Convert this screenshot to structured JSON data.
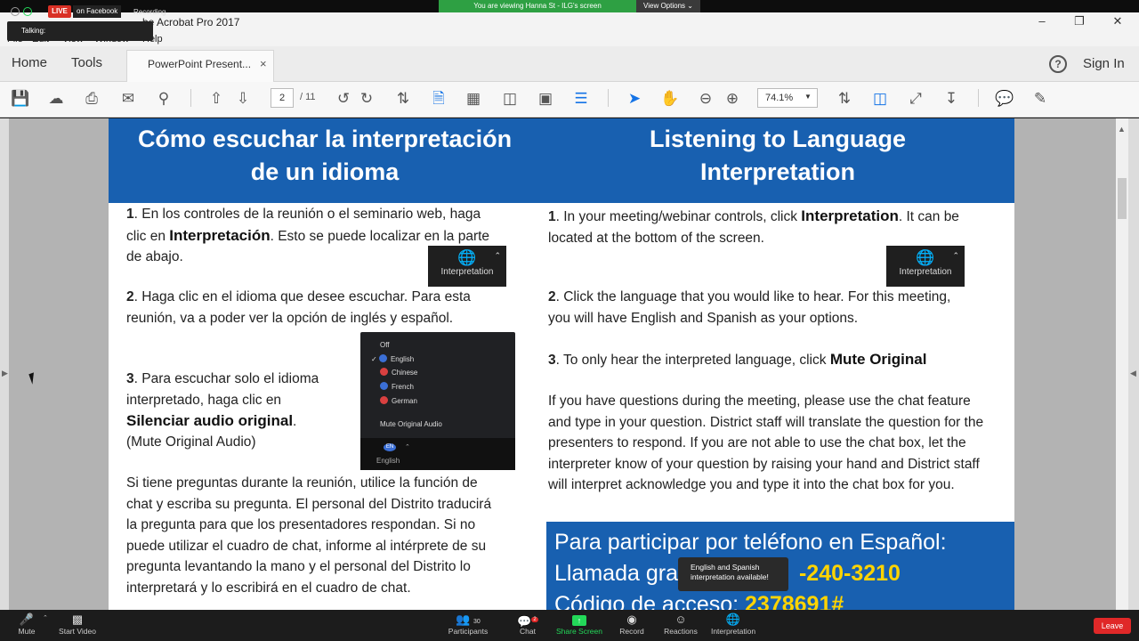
{
  "zoom": {
    "share_banner": "You are viewing Hanna St - ILG's screen",
    "view_options": "View Options ⌄",
    "live_badge": "LIVE",
    "live_target": "on Facebook",
    "recording_label": "Recording",
    "talking_label": "Talking:",
    "bottom_bar": [
      {
        "name": "mute",
        "label": "Mute",
        "icon": "microphone-icon"
      },
      {
        "name": "start-video",
        "label": "Start Video",
        "icon": "video-off-icon"
      },
      {
        "name": "participants",
        "label": "Participants",
        "icon": "participants-icon",
        "count": "30"
      },
      {
        "name": "chat",
        "label": "Chat",
        "icon": "chat-icon",
        "badge": "2"
      },
      {
        "name": "share-screen",
        "label": "Share Screen",
        "icon": "share-screen-icon"
      },
      {
        "name": "record",
        "label": "Record",
        "icon": "record-icon"
      },
      {
        "name": "reactions",
        "label": "Reactions",
        "icon": "reactions-icon"
      },
      {
        "name": "interpretation",
        "label": "Interpretation",
        "icon": "globe-icon"
      }
    ],
    "leave_label": "Leave",
    "toast": "English and Spanish interpretation available!"
  },
  "acrobat": {
    "window_title": "be Acrobat Pro 2017",
    "menu": [
      "File",
      "Edit",
      "View",
      "Window",
      "Help"
    ],
    "tabs": {
      "home": "Home",
      "tools": "Tools",
      "document": "PowerPoint Present...",
      "close": "×"
    },
    "help_glyph": "?",
    "sign_in": "Sign In",
    "page_current": "2",
    "page_total": "/ 11",
    "zoom_level": "74.1%"
  },
  "slide": {
    "es": {
      "title_line1": "Cómo escuchar la interpretación",
      "title_line2": "de un idioma",
      "step1_num": "1",
      "step1_pre": ". En los controles de la reunión o el seminario web, haga clic en ",
      "step1_kw": "Interpretación",
      "step1_post": ". Esto se puede localizar en la parte de abajo.",
      "step2_num": "2",
      "step2": ". Haga clic en el idioma que desee escuchar. Para esta reunión, va a poder ver la opción de inglés y español.",
      "step3_num": "3",
      "step3_pre": ". Para escuchar solo el idioma interpretado, haga clic en",
      "step3_kw": "Silenciar audio original",
      "step3_post": ".",
      "step3_note": "(Mute Original Audio)",
      "questions": "Si tiene preguntas durante la reunión, utilice la función de chat y escriba su pregunta. El personal del Distrito traducirá la pregunta para que los presentadores respondan. Si no puede utilizar el cuadro de chat, informe al intérprete de su pregunta levantando la mano y el personal del Distrito lo interpretará y lo escribirá en el cuadro de chat."
    },
    "en": {
      "title_line1": "Listening to Language",
      "title_line2": "Interpretation",
      "step1_num": "1",
      "step1_pre": ". In your meeting/webinar controls, click ",
      "step1_kw": "Interpretation",
      "step1_post": ". It can be located at the bottom of the screen.",
      "step2_num": "2",
      "step2": ". Click the language that you would like to hear. For this meeting, you will  have English and Spanish as your options.",
      "step3_num": "3",
      "step3_pre": ". To only hear the interpreted language, click ",
      "step3_kw": "Mute Original",
      "questions": "If you have questions during the meeting, please use the chat feature and type in your question. District staff will translate the question for the presenters to respond. If you are not able to use the chat box, let the interpreter  know  of your  question by raising  your hand and District staff will interpret acknowledge you  and type it  into  the chat box  for you.",
      "phone_line1": "Para participar por teléfono en Español:",
      "phone_line2_pre": "Llamada gra",
      "phone_line2_num": "-240-3210",
      "phone_line3_pre": "Código de acceso: ",
      "phone_line3_num": "2378691#"
    },
    "interp_widget_label": "Interpretation",
    "lang_menu": {
      "off": "Off",
      "items": [
        {
          "label": "English",
          "checked": true,
          "color": "#3b6fd6"
        },
        {
          "label": "Chinese",
          "checked": false,
          "color": "#d94040"
        },
        {
          "label": "French",
          "checked": false,
          "color": "#3b6fd6"
        },
        {
          "label": "German",
          "checked": false,
          "color": "#d94040"
        }
      ],
      "mute": "Mute Original Audio",
      "bottom_label": "English",
      "bottom_badge": "EN"
    }
  }
}
